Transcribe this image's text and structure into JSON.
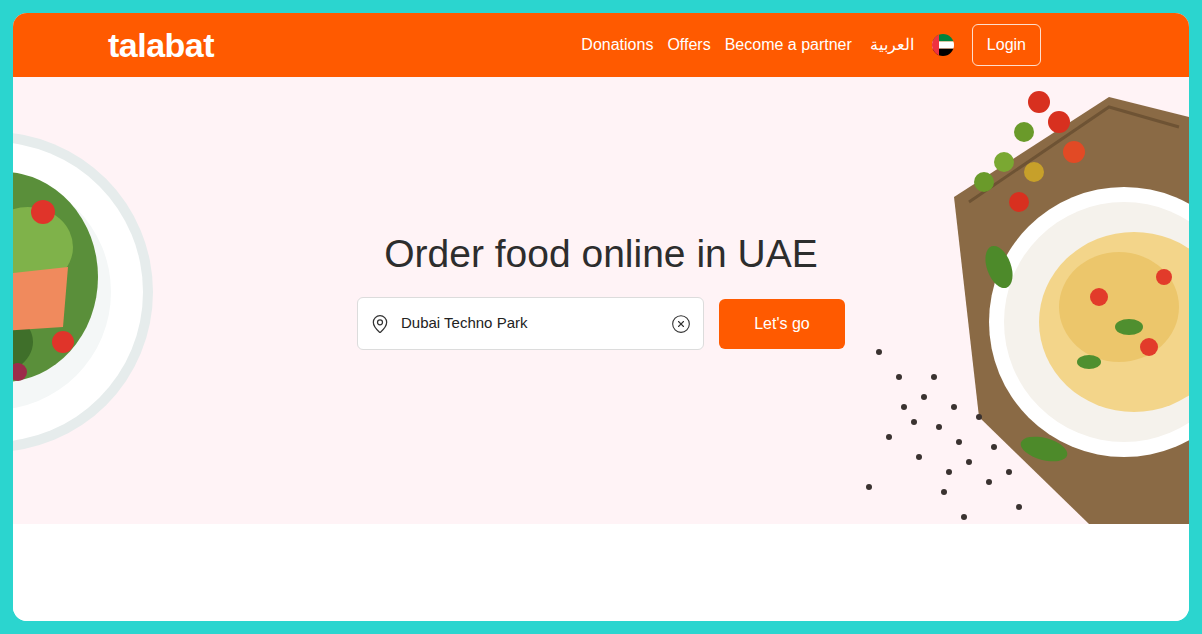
{
  "header": {
    "logo": "talabat",
    "nav": [
      {
        "label": "Donations"
      },
      {
        "label": "Offers"
      },
      {
        "label": "Become a partner"
      }
    ],
    "language": "العربية",
    "login": "Login"
  },
  "hero": {
    "title": "Order food online in UAE",
    "search": {
      "value": "Dubai Techno Park"
    },
    "button": "Let's go"
  }
}
